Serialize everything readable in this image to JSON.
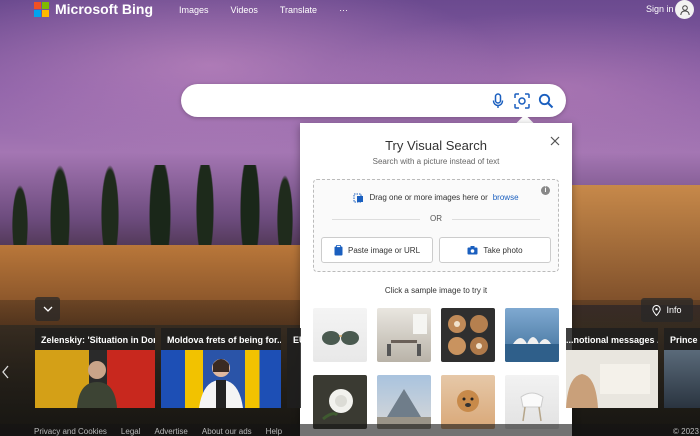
{
  "header": {
    "logo_text": "Microsoft Bing",
    "nav": [
      "Images",
      "Videos",
      "Translate",
      "···"
    ],
    "signin": "Sign in"
  },
  "search": {
    "value": "",
    "placeholder": ""
  },
  "visual_search": {
    "title": "Try Visual Search",
    "subtitle": "Search with a picture instead of text",
    "drop_text": "Drag one or more images here or",
    "browse": "browse",
    "or": "OR",
    "paste_button": "Paste image or URL",
    "photo_button": "Take photo",
    "sample_label": "Click a sample image to try it",
    "samples": [
      "sunglasses",
      "dining-room",
      "latte-art",
      "opera-house",
      "white-rose",
      "louvre-pyramid",
      "puppy",
      "white-chair"
    ]
  },
  "news": {
    "info_label": "Info",
    "cards": [
      {
        "title": "Zelenskiy: 'Situation in Don..."
      },
      {
        "title": "Moldova frets of being for..."
      },
      {
        "title": "EU"
      },
      {
        "title": "...notional messages ..."
      },
      {
        "title": "Prince Cl"
      }
    ]
  },
  "footer": {
    "links": [
      "Privacy and Cookies",
      "Legal",
      "Advertise",
      "About our ads",
      "Help"
    ],
    "copyright": "© 2023"
  },
  "colors": {
    "bing_red": "#f25022",
    "bing_green": "#7fba00",
    "bing_blue": "#00a4ef",
    "bing_yellow": "#ffb900",
    "accent_blue": "#1a5fbf"
  }
}
